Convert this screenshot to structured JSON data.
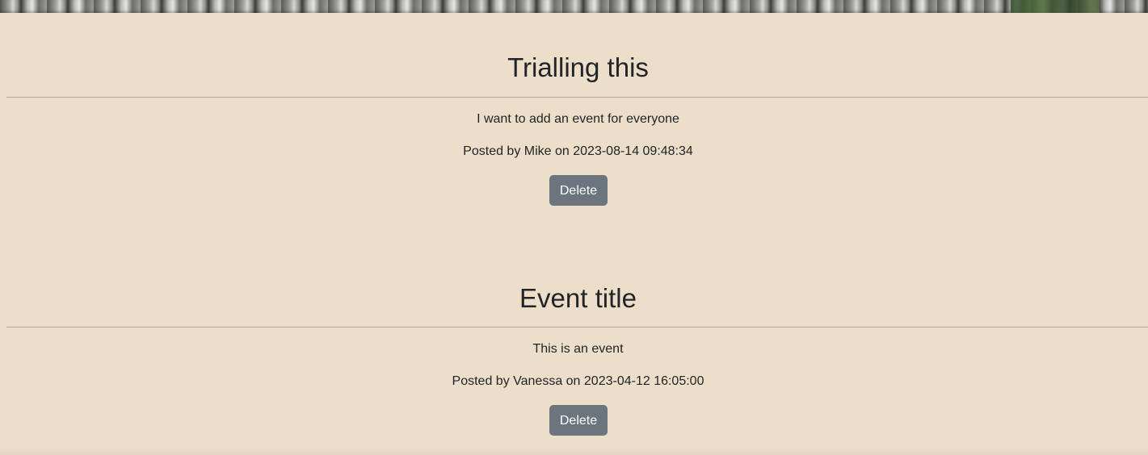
{
  "events": [
    {
      "title": "Trialling this",
      "description": "I want to add an event for everyone",
      "posted": "Posted by Mike on 2023-08-14 09:48:34",
      "delete_label": "Delete"
    },
    {
      "title": "Event title",
      "description": "This is an event",
      "posted": "Posted by Vanessa on 2023-04-12 16:05:00",
      "delete_label": "Delete"
    }
  ],
  "colors": {
    "background": "#ecdec8",
    "button": "#6c757d",
    "text": "#212529"
  }
}
